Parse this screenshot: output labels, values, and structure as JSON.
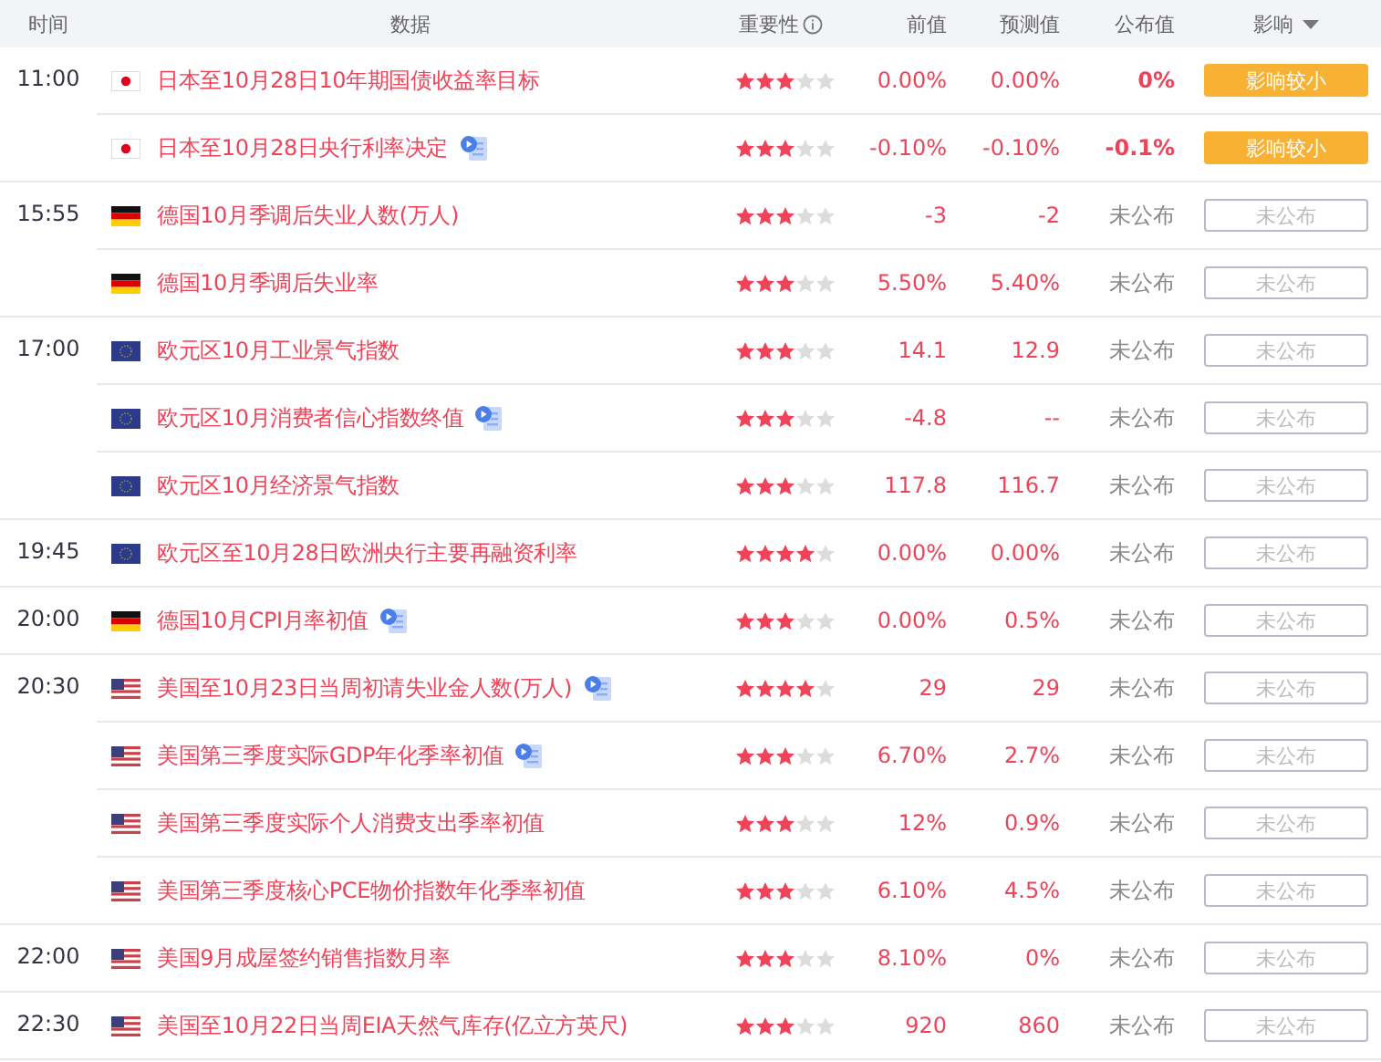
{
  "header": {
    "time": "时间",
    "data": "数据",
    "importance": "重要性",
    "previous": "前值",
    "forecast": "预测值",
    "actual": "公布值",
    "impact": "影响"
  },
  "groups": [
    {
      "time": "11:00",
      "events": [
        {
          "flag": {
            "kind": "jp"
          },
          "title": "日本至10月28日10年期国债收益率目标",
          "video": false,
          "stars": 3,
          "previous": "0.00%",
          "forecast": "0.00%",
          "actual": {
            "text": "0%",
            "released": true
          },
          "impact": {
            "kind": "small",
            "text": "影响较小"
          }
        },
        {
          "flag": {
            "kind": "jp"
          },
          "title": "日本至10月28日央行利率决定",
          "video": true,
          "stars": 3,
          "previous": "-0.10%",
          "forecast": "-0.10%",
          "actual": {
            "text": "-0.1%",
            "released": true
          },
          "impact": {
            "kind": "small",
            "text": "影响较小"
          }
        }
      ]
    },
    {
      "time": "15:55",
      "events": [
        {
          "flag": {
            "kind": "de"
          },
          "title": "德国10月季调后失业人数(万人)",
          "video": false,
          "stars": 3,
          "previous": "-3",
          "forecast": "-2",
          "actual": {
            "text": "未公布",
            "released": false
          },
          "impact": {
            "kind": "pending",
            "text": "未公布"
          }
        },
        {
          "flag": {
            "kind": "de"
          },
          "title": "德国10月季调后失业率",
          "video": false,
          "stars": 3,
          "previous": "5.50%",
          "forecast": "5.40%",
          "actual": {
            "text": "未公布",
            "released": false
          },
          "impact": {
            "kind": "pending",
            "text": "未公布"
          }
        }
      ]
    },
    {
      "time": "17:00",
      "events": [
        {
          "flag": {
            "kind": "eu"
          },
          "title": "欧元区10月工业景气指数",
          "video": false,
          "stars": 3,
          "previous": "14.1",
          "forecast": "12.9",
          "actual": {
            "text": "未公布",
            "released": false
          },
          "impact": {
            "kind": "pending",
            "text": "未公布"
          }
        },
        {
          "flag": {
            "kind": "eu"
          },
          "title": "欧元区10月消费者信心指数终值",
          "video": true,
          "stars": 3,
          "previous": "-4.8",
          "forecast": "--",
          "actual": {
            "text": "未公布",
            "released": false
          },
          "impact": {
            "kind": "pending",
            "text": "未公布"
          }
        },
        {
          "flag": {
            "kind": "eu"
          },
          "title": "欧元区10月经济景气指数",
          "video": false,
          "stars": 3,
          "previous": "117.8",
          "forecast": "116.7",
          "actual": {
            "text": "未公布",
            "released": false
          },
          "impact": {
            "kind": "pending",
            "text": "未公布"
          }
        }
      ]
    },
    {
      "time": "19:45",
      "events": [
        {
          "flag": {
            "kind": "eu"
          },
          "title": "欧元区至10月28日欧洲央行主要再融资利率",
          "video": false,
          "stars": 4,
          "previous": "0.00%",
          "forecast": "0.00%",
          "actual": {
            "text": "未公布",
            "released": false
          },
          "impact": {
            "kind": "pending",
            "text": "未公布"
          }
        }
      ]
    },
    {
      "time": "20:00",
      "events": [
        {
          "flag": {
            "kind": "de"
          },
          "title": "德国10月CPI月率初值",
          "video": true,
          "stars": 3,
          "previous": "0.00%",
          "forecast": "0.5%",
          "actual": {
            "text": "未公布",
            "released": false
          },
          "impact": {
            "kind": "pending",
            "text": "未公布"
          }
        }
      ]
    },
    {
      "time": "20:30",
      "events": [
        {
          "flag": {
            "kind": "us"
          },
          "title": "美国至10月23日当周初请失业金人数(万人)",
          "video": true,
          "stars": 4,
          "previous": "29",
          "forecast": "29",
          "actual": {
            "text": "未公布",
            "released": false
          },
          "impact": {
            "kind": "pending",
            "text": "未公布"
          }
        },
        {
          "flag": {
            "kind": "us"
          },
          "title": "美国第三季度实际GDP年化季率初值",
          "video": true,
          "stars": 3,
          "previous": "6.70%",
          "forecast": "2.7%",
          "actual": {
            "text": "未公布",
            "released": false
          },
          "impact": {
            "kind": "pending",
            "text": "未公布"
          }
        },
        {
          "flag": {
            "kind": "us"
          },
          "title": "美国第三季度实际个人消费支出季率初值",
          "video": false,
          "stars": 3,
          "previous": "12%",
          "forecast": "0.9%",
          "actual": {
            "text": "未公布",
            "released": false
          },
          "impact": {
            "kind": "pending",
            "text": "未公布"
          }
        },
        {
          "flag": {
            "kind": "us"
          },
          "title": "美国第三季度核心PCE物价指数年化季率初值",
          "video": false,
          "stars": 3,
          "previous": "6.10%",
          "forecast": "4.5%",
          "actual": {
            "text": "未公布",
            "released": false
          },
          "impact": {
            "kind": "pending",
            "text": "未公布"
          }
        }
      ]
    },
    {
      "time": "22:00",
      "events": [
        {
          "flag": {
            "kind": "us"
          },
          "title": "美国9月成屋签约销售指数月率",
          "video": false,
          "stars": 3,
          "previous": "8.10%",
          "forecast": "0%",
          "actual": {
            "text": "未公布",
            "released": false
          },
          "impact": {
            "kind": "pending",
            "text": "未公布"
          }
        }
      ]
    },
    {
      "time": "22:30",
      "events": [
        {
          "flag": {
            "kind": "us"
          },
          "title": "美国至10月22日当周EIA天然气库存(亿立方英尺)",
          "video": false,
          "stars": 3,
          "previous": "920",
          "forecast": "860",
          "actual": {
            "text": "未公布",
            "released": false
          },
          "impact": {
            "kind": "pending",
            "text": "未公布"
          }
        }
      ]
    }
  ]
}
